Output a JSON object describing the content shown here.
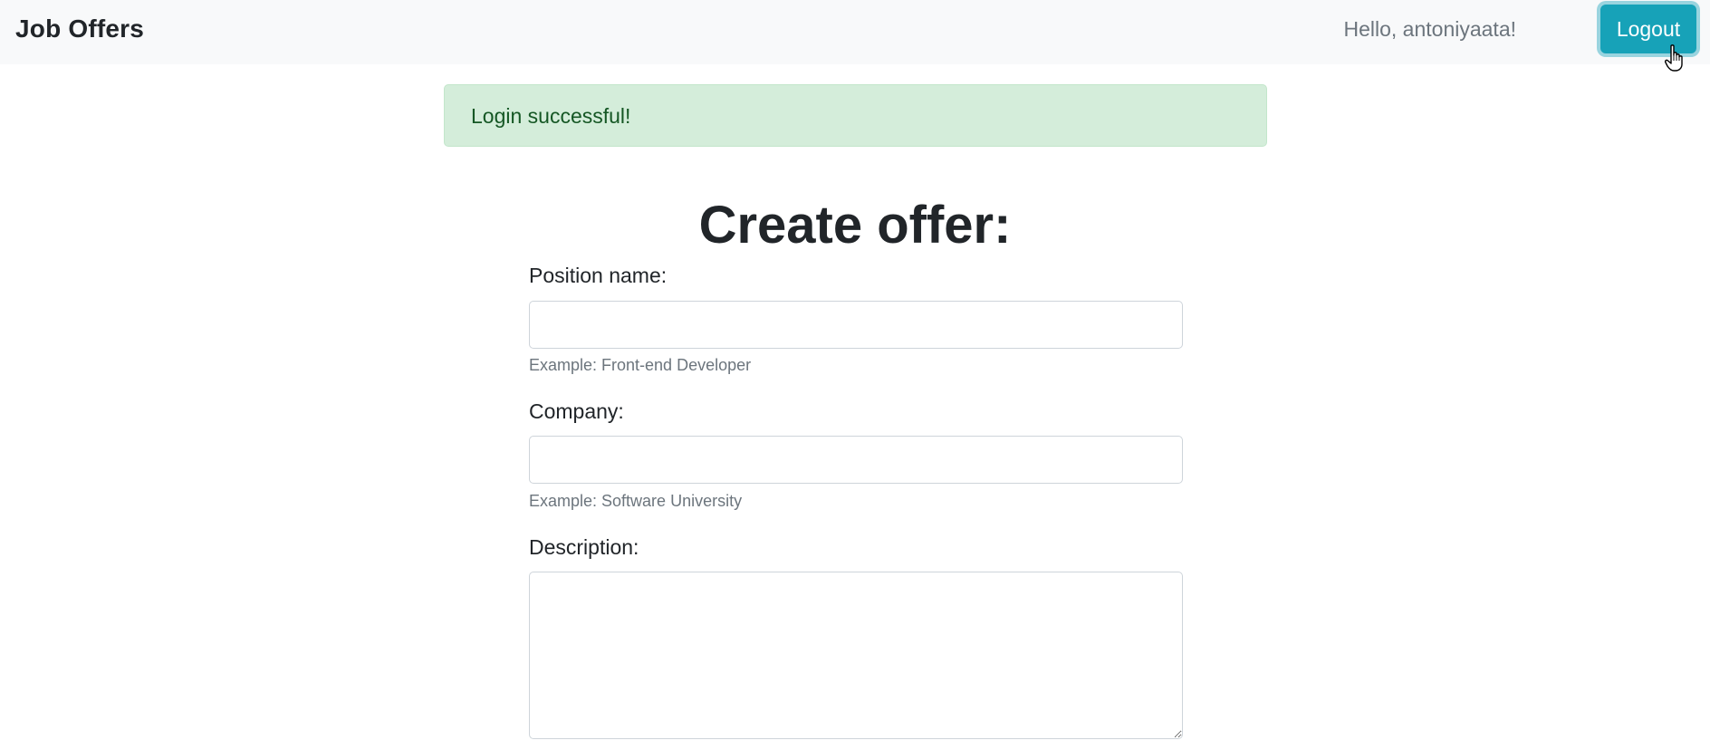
{
  "navbar": {
    "brand": "Job Offers",
    "greeting": "Hello, antoniyaata!",
    "logout_label": "Logout"
  },
  "alert": {
    "message": "Login successful!",
    "type": "success"
  },
  "form": {
    "title": "Create offer:",
    "position": {
      "label": "Position name:",
      "value": "",
      "help": "Example: Front-end Developer"
    },
    "company": {
      "label": "Company:",
      "value": "",
      "help": "Example: Software University"
    },
    "description": {
      "label": "Description:",
      "value": ""
    }
  },
  "colors": {
    "navbar_bg": "#f8f9fa",
    "logout_bg": "#17a2b8",
    "alert_bg": "#d4edda",
    "alert_text": "#155724",
    "muted_text": "#6c757d"
  },
  "icons": {
    "cursor": "hand-pointer-icon"
  }
}
